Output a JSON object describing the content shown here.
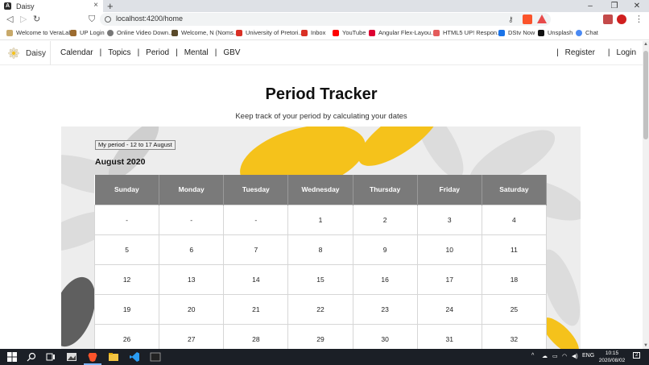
{
  "browser": {
    "tab_title": "Daisy",
    "tab_favicon_letter": "A",
    "new_tab_symbol": "+",
    "url": "localhost:4200/home",
    "window_controls": [
      "–",
      "❐",
      "✕"
    ],
    "bookmarks": [
      {
        "label": "Welcome to VeraLab",
        "icon": "veralab-icon",
        "color": "#c8a96a"
      },
      {
        "label": "UP Login",
        "icon": "up-login-icon",
        "color": "#9c6b2f"
      },
      {
        "label": "Online Video Down...",
        "icon": "globe-icon",
        "color": "#777777"
      },
      {
        "label": "Welcome, N (Noms...",
        "icon": "bookmark-site-icon",
        "color": "#5a4a2a"
      },
      {
        "label": "University of Pretori...",
        "icon": "gmail-icon",
        "color": "#d93025"
      },
      {
        "label": "Inbox",
        "icon": "gmail-icon",
        "color": "#d93025"
      },
      {
        "label": "YouTube",
        "icon": "youtube-icon",
        "color": "#ff0000"
      },
      {
        "label": "Angular Flex-Layou...",
        "icon": "angular-icon",
        "color": "#dd0031"
      },
      {
        "label": "HTML5 UP! Respon...",
        "icon": "html5up-icon",
        "color": "#e45c5c"
      },
      {
        "label": "DStv Now",
        "icon": "dstv-icon",
        "color": "#1a73e8"
      },
      {
        "label": "Unsplash",
        "icon": "unsplash-icon",
        "color": "#111111"
      },
      {
        "label": "Chat",
        "icon": "chat-icon",
        "color": "#4a8af4"
      }
    ]
  },
  "app": {
    "brand": "Daisy",
    "nav_links": [
      "Calendar",
      "Topics",
      "Period",
      "Mental",
      "GBV"
    ],
    "separator": "|",
    "right_links": [
      "Register",
      "Login"
    ],
    "title": "Period Tracker",
    "subtitle": "Keep track of your period by calculating your dates",
    "period_chip": "My period - 12 to 17 August",
    "month": "August 2020",
    "weekdays": [
      "Sunday",
      "Monday",
      "Tuesday",
      "Wednesday",
      "Thursday",
      "Friday",
      "Saturday"
    ],
    "weeks": [
      [
        "-",
        "-",
        "-",
        "1",
        "2",
        "3",
        "4"
      ],
      [
        "5",
        "6",
        "7",
        "8",
        "9",
        "10",
        "11"
      ],
      [
        "12",
        "13",
        "14",
        "15",
        "16",
        "17",
        "18"
      ],
      [
        "19",
        "20",
        "21",
        "22",
        "23",
        "24",
        "25"
      ],
      [
        "26",
        "27",
        "28",
        "29",
        "30",
        "31",
        "32"
      ]
    ],
    "colors": {
      "header_bg": "#7a7a7a",
      "daisy_yellow": "#f5c21b",
      "petal_grey": "#d4d4d4",
      "petal_dark": "#5f5f5f"
    }
  },
  "taskbar": {
    "language": "ENG",
    "time": "10:15",
    "date": "2020/08/02",
    "notifications": "2"
  }
}
